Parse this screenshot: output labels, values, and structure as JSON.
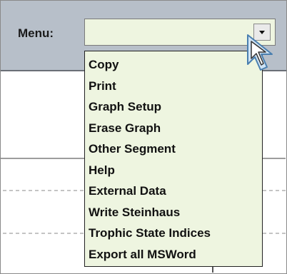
{
  "menu": {
    "label": "Menu:",
    "selected_value": "",
    "items": [
      "Copy",
      "Print",
      "Graph Setup",
      "Erase Graph",
      "Other Segment",
      "Help",
      "External Data",
      "Write Steinhaus",
      "Trophic State Indices",
      "Export all MSWord"
    ]
  },
  "colors": {
    "header_bg": "#b7bfc9",
    "dropdown_bg": "#eef5e0"
  },
  "icons": {
    "combo_arrow": "chevron-down-icon",
    "pointer": "mouse-cursor-icon"
  }
}
